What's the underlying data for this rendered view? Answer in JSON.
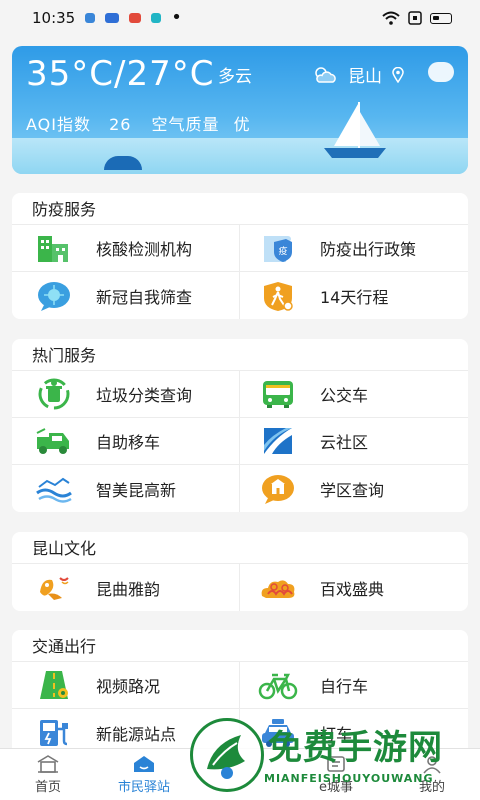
{
  "status_bar": {
    "time": "10:35"
  },
  "weather": {
    "temperature": "35°C/27°C",
    "condition": "多云",
    "city": "昆山",
    "aqi_label": "AQI指数",
    "aqi_value": "26",
    "quality_label": "空气质量",
    "quality_value": "优"
  },
  "sections": [
    {
      "title": "防疫服务",
      "items": [
        {
          "label": "核酸检测机构",
          "icon": "building-icon"
        },
        {
          "label": "防疫出行政策",
          "icon": "shield-document-icon"
        },
        {
          "label": "新冠自我筛查",
          "icon": "virus-chat-icon"
        },
        {
          "label": "14天行程",
          "icon": "walking-person-icon"
        }
      ]
    },
    {
      "title": "热门服务",
      "items": [
        {
          "label": "垃圾分类查询",
          "icon": "recycle-bin-icon"
        },
        {
          "label": "公交车",
          "icon": "bus-icon"
        },
        {
          "label": "自助移车",
          "icon": "tow-truck-icon"
        },
        {
          "label": "云社区",
          "icon": "community-logo-icon"
        },
        {
          "label": "智美昆高新",
          "icon": "city-wave-icon"
        },
        {
          "label": "学区查询",
          "icon": "school-chat-icon"
        }
      ]
    },
    {
      "title": "昆山文化",
      "items": [
        {
          "label": "昆曲雅韵",
          "icon": "opera-icon"
        },
        {
          "label": "百戏盛典",
          "icon": "cloud-pattern-icon"
        }
      ]
    },
    {
      "title": "交通出行",
      "items": [
        {
          "label": "视频路况",
          "icon": "road-camera-icon"
        },
        {
          "label": "自行车",
          "icon": "bicycle-icon"
        },
        {
          "label": "新能源站点",
          "icon": "charging-station-icon"
        },
        {
          "label": "打车",
          "icon": "taxi-icon"
        }
      ]
    }
  ],
  "bottom_nav": [
    {
      "label": "首页",
      "active": false
    },
    {
      "label": "市民驿站",
      "active": true
    },
    {
      "label": "",
      "active": false
    },
    {
      "label": "e城事",
      "active": false
    },
    {
      "label": "我的",
      "active": false
    }
  ],
  "watermark": {
    "title": "免费手游网",
    "subtitle": "MIANFEISHOUYOUWANG"
  },
  "colors": {
    "accent": "#2a83d6",
    "icon_green": "#3bb54a",
    "icon_orange": "#f0a020",
    "icon_blue": "#3a86d8"
  }
}
